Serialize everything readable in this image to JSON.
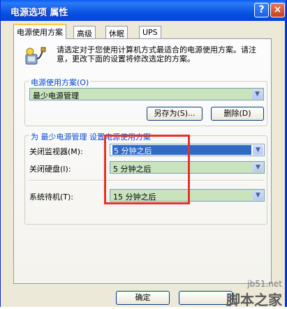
{
  "window": {
    "title": "电源选项 属性"
  },
  "titlebar": {
    "help_glyph": "?",
    "close_glyph": "×"
  },
  "tabs": [
    {
      "label": "电源使用方案",
      "active": true
    },
    {
      "label": "高级"
    },
    {
      "label": "休眠"
    },
    {
      "label": "UPS"
    }
  ],
  "description": "请选定对于您使用计算机方式最适合的电源使用方案。请注意，更改下面的设置将修改选定的方案。",
  "schemes_group": {
    "legend": "电源使用方案(O)",
    "selected": "最少电源管理",
    "save_as_label": "另存为(S)...",
    "delete_label": "删除(D)"
  },
  "settings_group": {
    "legend": "为 最少电源管理 设置电源使用方案",
    "rows": [
      {
        "label": "关闭监视器(M):",
        "value": "5 分钟之后"
      },
      {
        "label": "关闭硬盘(I):",
        "value": "5 分钟之后"
      },
      {
        "label": "系统待机(T):",
        "value": "15 分钟之后"
      }
    ]
  },
  "footer": {
    "ok_label": "确定"
  },
  "watermark": {
    "site": "jb51.net",
    "name": "脚本之家"
  },
  "colors": {
    "title_bar": "#0a53e4",
    "highlight": "#316ac5",
    "annotation": "#e8312a"
  }
}
